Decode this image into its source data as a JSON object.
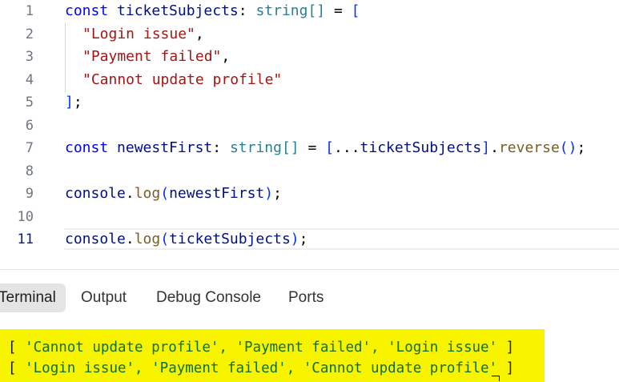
{
  "editor": {
    "line_numbers": [
      "1",
      "2",
      "3",
      "4",
      "5",
      "6",
      "7",
      "8",
      "9",
      "10",
      "11"
    ],
    "active_line": "11",
    "code": {
      "l1": {
        "kw": "const",
        "name": "ticketSubjects",
        "colon": ":",
        "type": "string[]",
        "eq": "=",
        "open": "["
      },
      "l2": {
        "str": "\"Login issue\"",
        "comma": ","
      },
      "l3": {
        "str": "\"Payment failed\"",
        "comma": ","
      },
      "l4": {
        "str": "\"Cannot update profile\""
      },
      "l5": {
        "close": "]",
        "semi": ";"
      },
      "l7": {
        "kw": "const",
        "name": "newestFirst",
        "colon": ":",
        "type": "string[]",
        "eq": "=",
        "open": "[",
        "spread": "...",
        "ref": "ticketSubjects",
        "close": "]",
        "dot": ".",
        "method": "reverse",
        "parens": "()",
        "semi": ";"
      },
      "l9": {
        "obj": "console",
        "dot": ".",
        "method": "log",
        "open": "(",
        "arg": "newestFirst",
        "close": ")",
        "semi": ";"
      },
      "l11": {
        "obj": "console",
        "dot": ".",
        "method": "log",
        "open": "(",
        "arg": "ticketSubjects",
        "close": ")",
        "semi": ";"
      }
    }
  },
  "panel": {
    "tabs": [
      {
        "label": "Terminal",
        "active": true
      },
      {
        "label": "Output",
        "active": false
      },
      {
        "label": "Debug Console",
        "active": false
      },
      {
        "label": "Ports",
        "active": false
      }
    ],
    "terminal_lines": [
      {
        "open": "[",
        "content": " 'Cannot update profile', 'Payment failed', 'Login issue' ",
        "close": "]"
      },
      {
        "open": "[",
        "content": " 'Login issue', 'Payment failed', 'Cannot update profile' ",
        "close": "]"
      }
    ],
    "highlight_color": "#f8f400"
  }
}
